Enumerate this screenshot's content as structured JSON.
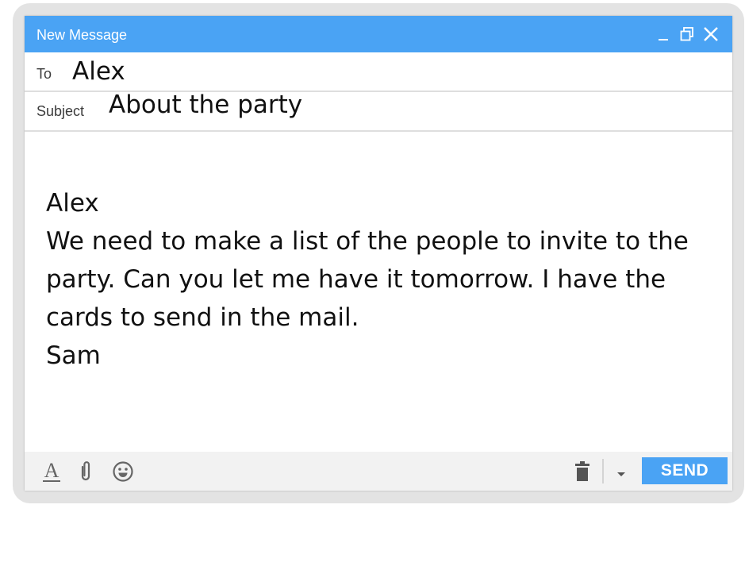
{
  "window": {
    "title": "New Message"
  },
  "fields": {
    "to_label": "To",
    "to_value": "Alex",
    "subject_label": "Subject",
    "subject_value": "About the party"
  },
  "message": {
    "lines": [
      "Alex",
      "We need to make a list of the people to invite to the",
      "party. Can you let me have it tomorrow. I have the",
      "cards to send in the mail.",
      "Sam"
    ]
  },
  "toolbar": {
    "send_label": "SEND",
    "icons": [
      "format-text-icon",
      "attachment-icon",
      "emoji-icon",
      "trash-icon",
      "caret-down-icon"
    ]
  },
  "colors": {
    "accent": "#4aa3f4",
    "toolbar_bg": "#f2f2f2",
    "icon": "#666666"
  }
}
